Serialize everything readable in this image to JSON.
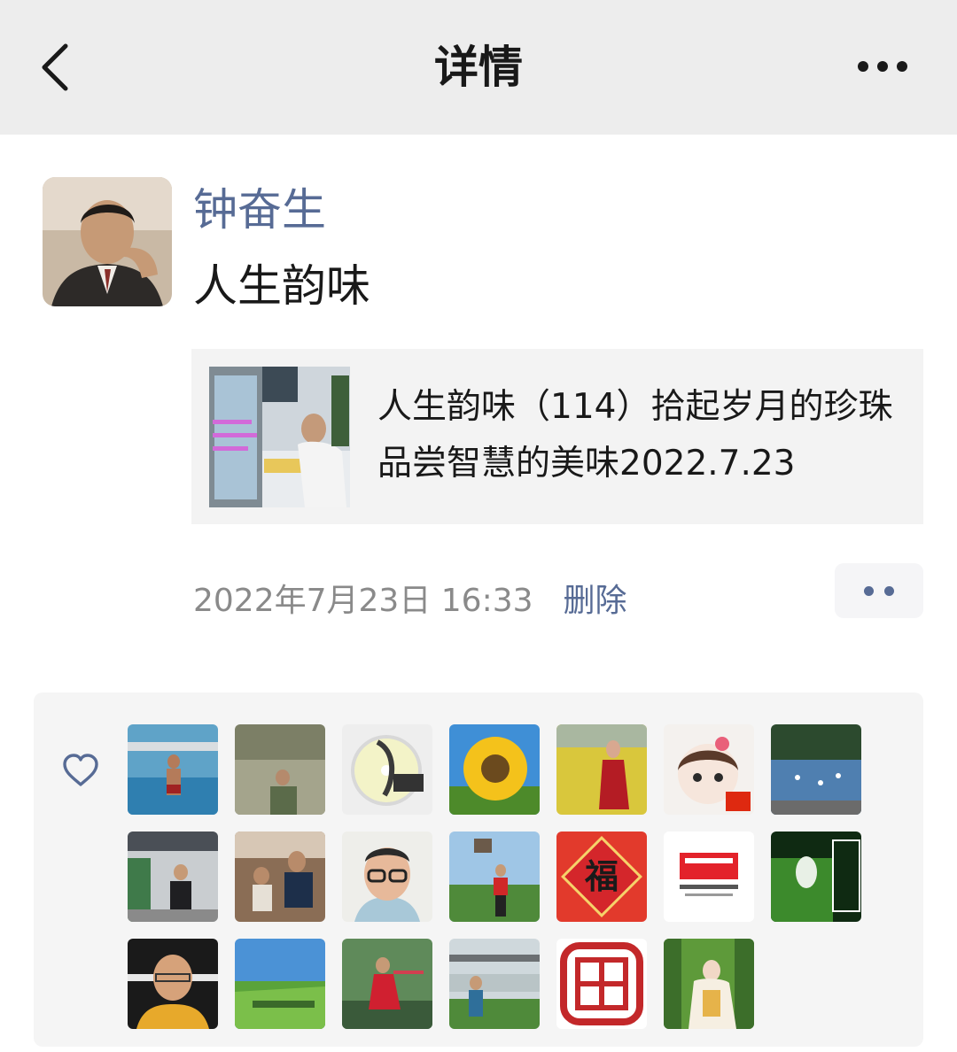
{
  "navbar": {
    "title": "详情",
    "back_icon": "chevron-left-icon",
    "more_icon": "more-dots-icon"
  },
  "post": {
    "author": "钟奋生",
    "text": "人生韵味",
    "link": {
      "title": "人生韵味（114）拾起岁月的珍珠 品尝智慧的美味2022.7.23"
    },
    "time": "2022年7月23日 16:33",
    "delete_label": "删除"
  },
  "likes": {
    "icon": "heart-icon",
    "count": 20,
    "seal_char": "福"
  },
  "colors": {
    "link_blue": "#576b95",
    "navbar_bg": "#ededed",
    "card_bg": "#f3f3f3",
    "likes_bg": "#f5f5f5"
  }
}
